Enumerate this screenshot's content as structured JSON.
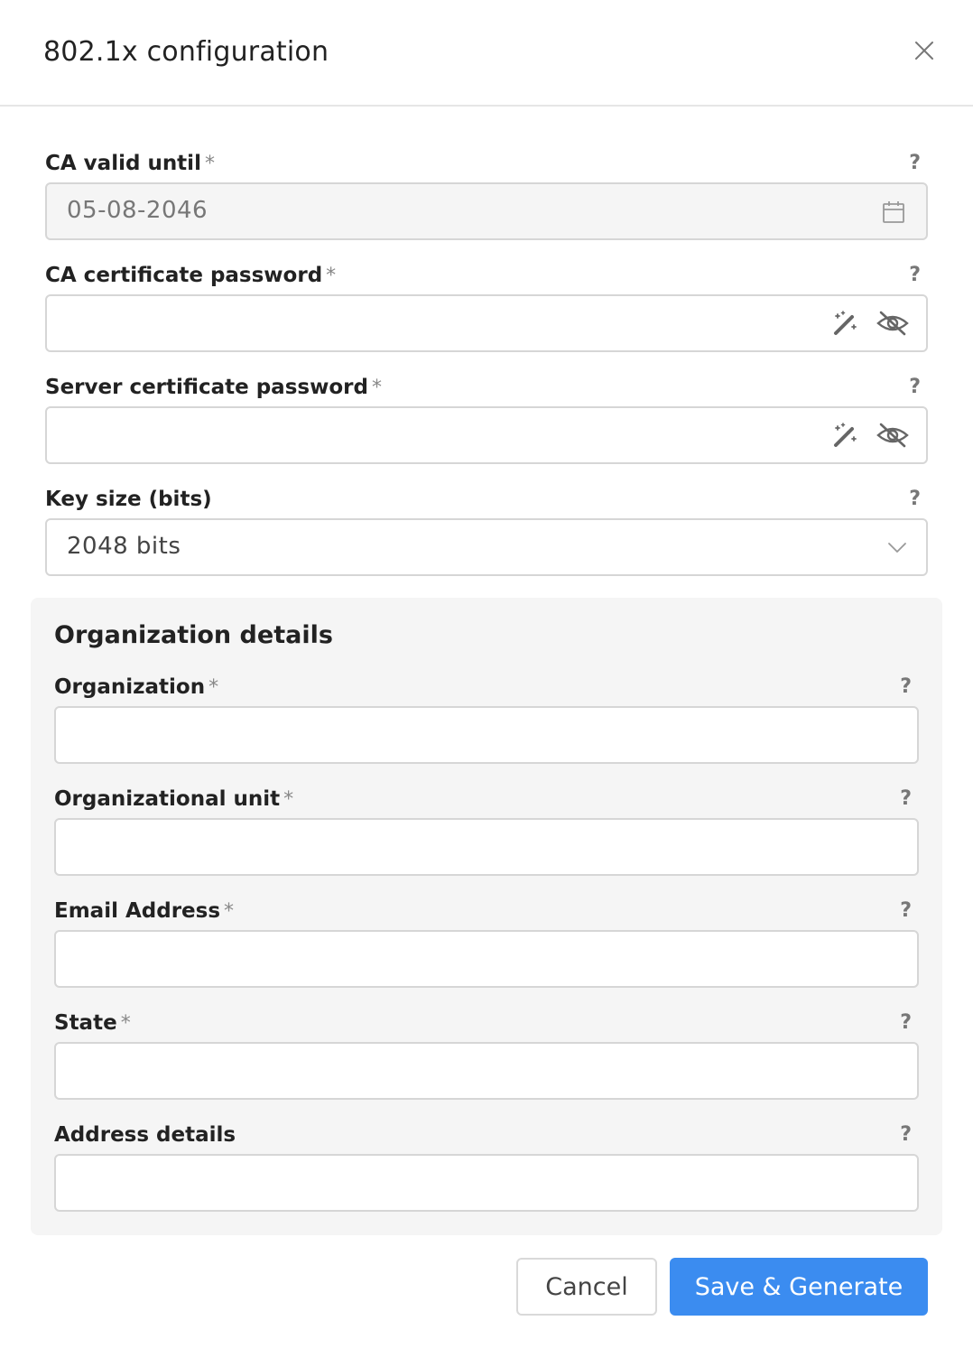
{
  "dialog": {
    "title": "802.1x configuration"
  },
  "fields": {
    "ca_valid_until": {
      "label": "CA valid until",
      "required": "*",
      "help": "?",
      "value": "05-08-2046"
    },
    "ca_cert_password": {
      "label": "CA certificate password",
      "required": "*",
      "help": "?",
      "value": ""
    },
    "server_cert_password": {
      "label": "Server certificate password",
      "required": "*",
      "help": "?",
      "value": ""
    },
    "key_size": {
      "label": "Key size (bits)",
      "help": "?",
      "value": "2048 bits"
    }
  },
  "organization": {
    "title": "Organization details",
    "organization": {
      "label": "Organization",
      "required": "*",
      "help": "?",
      "value": ""
    },
    "org_unit": {
      "label": "Organizational unit",
      "required": "*",
      "help": "?",
      "value": ""
    },
    "email": {
      "label": "Email Address",
      "required": "*",
      "help": "?",
      "value": ""
    },
    "state": {
      "label": "State",
      "required": "*",
      "help": "?",
      "value": ""
    },
    "address": {
      "label": "Address details",
      "help": "?",
      "value": ""
    }
  },
  "buttons": {
    "cancel": "Cancel",
    "save": "Save & Generate"
  },
  "colors": {
    "primary": "#3b8cf0",
    "panel_bg": "#f5f5f5",
    "border": "#d6d6d6"
  }
}
